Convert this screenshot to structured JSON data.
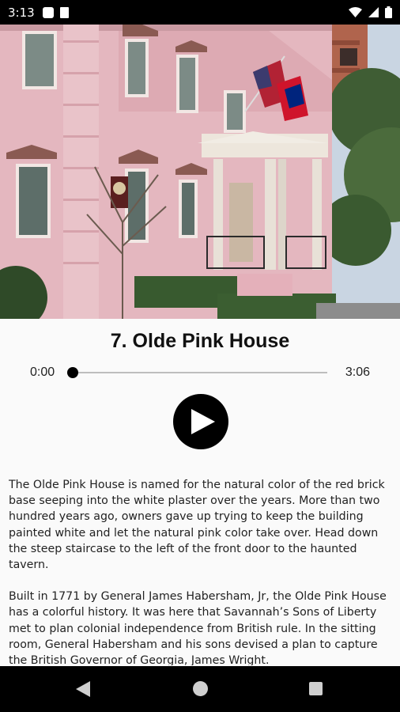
{
  "status_bar": {
    "time": "3:13",
    "left_icons": [
      "app-notification-icon",
      "sd-card-icon"
    ],
    "right_icons": [
      "wifi-icon",
      "signal-icon",
      "battery-icon"
    ]
  },
  "hero": {
    "image_subject": "pink-house-photo"
  },
  "stop": {
    "title": "7. Olde Pink House"
  },
  "player": {
    "elapsed": "0:00",
    "duration": "3:06",
    "progress": 0.0
  },
  "description": {
    "paragraphs": [
      "The Olde Pink House is named for the natural color of the red brick base seeping into the white plaster over the years. More than two hundred years ago, owners gave up trying to keep the building painted white and let the natural pink color take over. Head down the steep staircase to the left of the front door to the haunted tavern.",
      "Built in 1771 by General James Habersham, Jr, the Olde Pink House has a colorful history. It was here that Savannah’s Sons of Liberty met to plan colonial independence from British rule. In the sitting room, General Habersham and his sons devised a plan to capture the British Governor of Georgia, James Wright."
    ]
  },
  "nav": {
    "icons": [
      "back-icon",
      "home-icon",
      "recents-icon"
    ]
  },
  "colors": {
    "background": "#fafafa",
    "bars": "#000000",
    "text": "#222222",
    "track": "#bdbdbd"
  }
}
